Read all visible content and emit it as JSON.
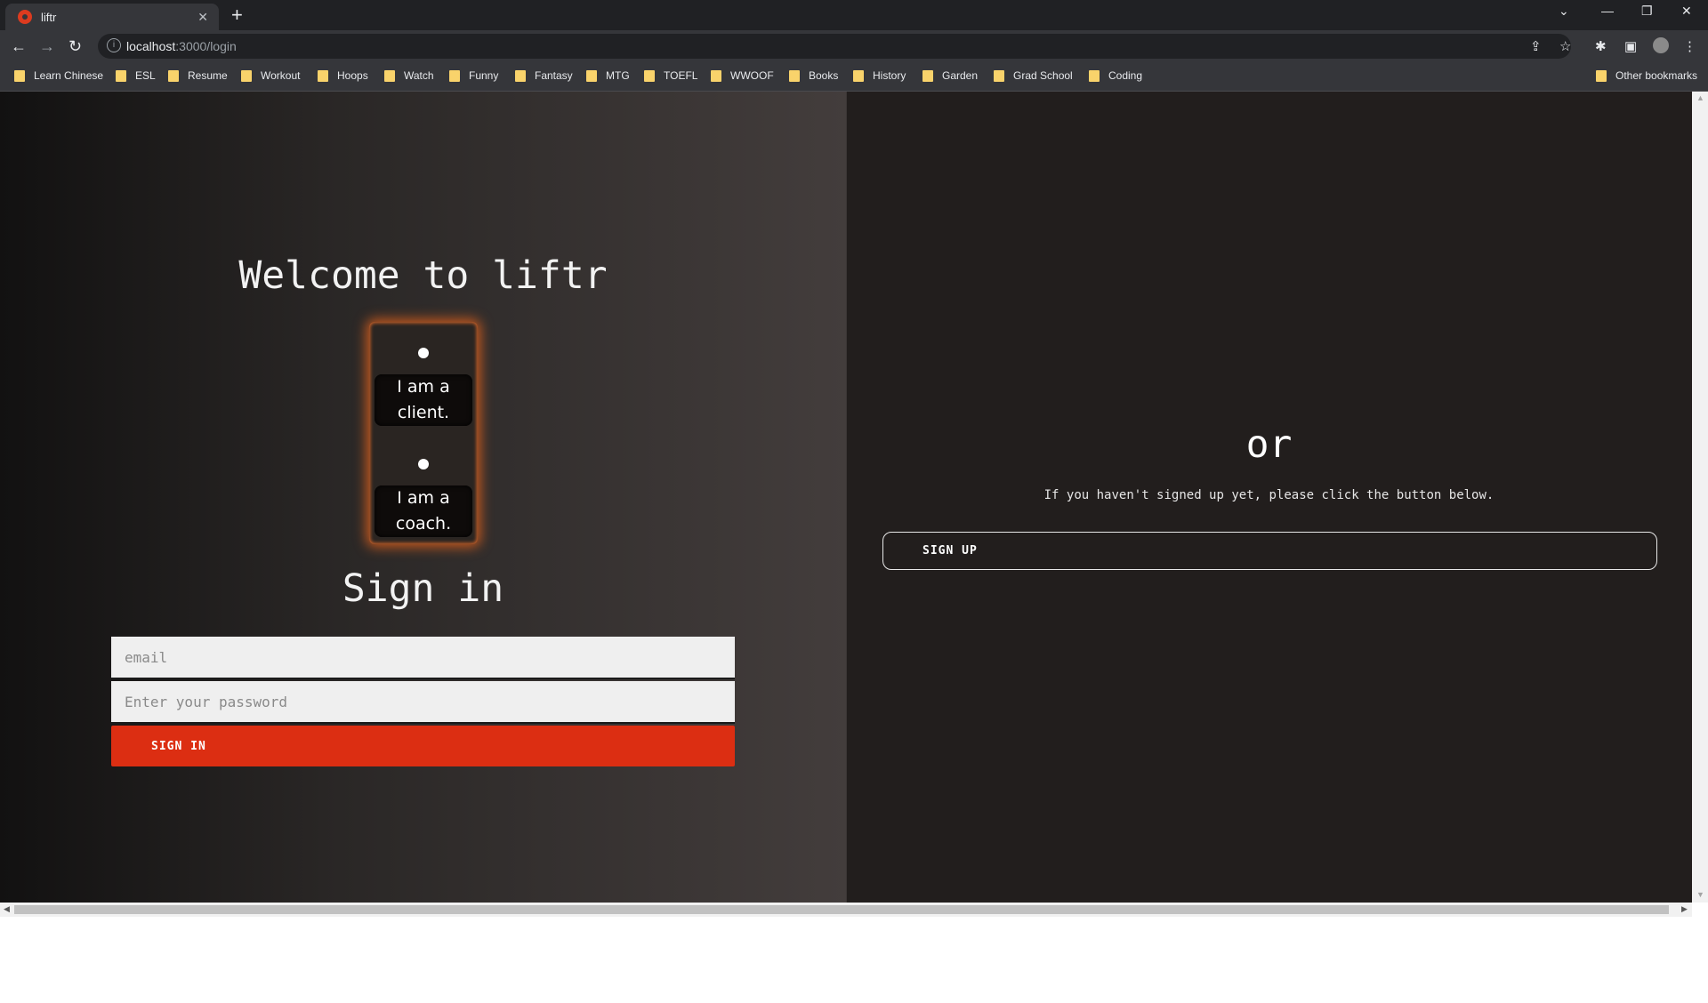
{
  "browser": {
    "tab_title": "liftr",
    "url_host": "localhost",
    "url_path": ":3000/login",
    "bookmarks": [
      "Learn Chinese",
      "ESL",
      "Resume",
      "Workout",
      "Hoops",
      "Watch",
      "Funny",
      "Fantasy",
      "MTG",
      "TOEFL",
      "WWOOF",
      "Books",
      "History",
      "Garden",
      "Grad School",
      "Coding"
    ],
    "other_bookmarks": "Other bookmarks"
  },
  "login": {
    "welcome": "Welcome to liftr",
    "roles": [
      "I am a client.",
      "I am a coach."
    ],
    "signin_title": "Sign in",
    "email_placeholder": "email",
    "password_placeholder": "Enter your password",
    "signin_button": "SIGN IN"
  },
  "signup": {
    "or": "or",
    "hint": "If you haven't signed up yet, please click the button below.",
    "button": "SIGN UP"
  },
  "colors": {
    "accent": "#dc2e12",
    "glow": "#c95a1e",
    "panel_right": "#221e1d"
  }
}
